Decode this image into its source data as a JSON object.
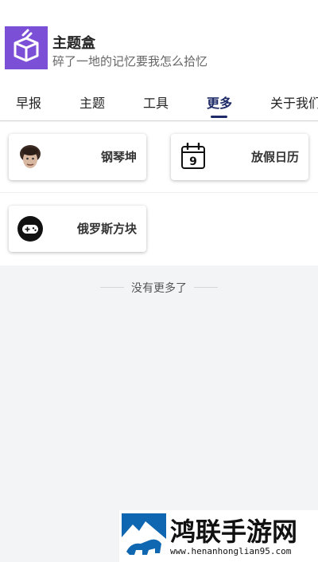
{
  "header": {
    "title": "主题盒",
    "subtitle": "碎了一地的记忆要我怎么拾忆",
    "brand_color": "#7b4fd6"
  },
  "tabs": [
    {
      "label": "早报",
      "active": false
    },
    {
      "label": "主题",
      "active": false
    },
    {
      "label": "工具",
      "active": false
    },
    {
      "label": "更多",
      "active": true
    },
    {
      "label": "关于我们",
      "active": false
    }
  ],
  "cards": [
    {
      "label": "钢琴坤",
      "icon": "avatar-icon"
    },
    {
      "label": "放假日历",
      "icon": "calendar-icon",
      "icon_text": "9"
    },
    {
      "label": "俄罗斯方块",
      "icon": "gamepad-icon"
    }
  ],
  "footer": {
    "end_text": "没有更多了"
  },
  "watermark": {
    "title": "鸿联手游网",
    "url": "www.henanhonglian95.com"
  },
  "colors": {
    "active_tab": "#1e2b68",
    "background": "#f3f4f6"
  }
}
